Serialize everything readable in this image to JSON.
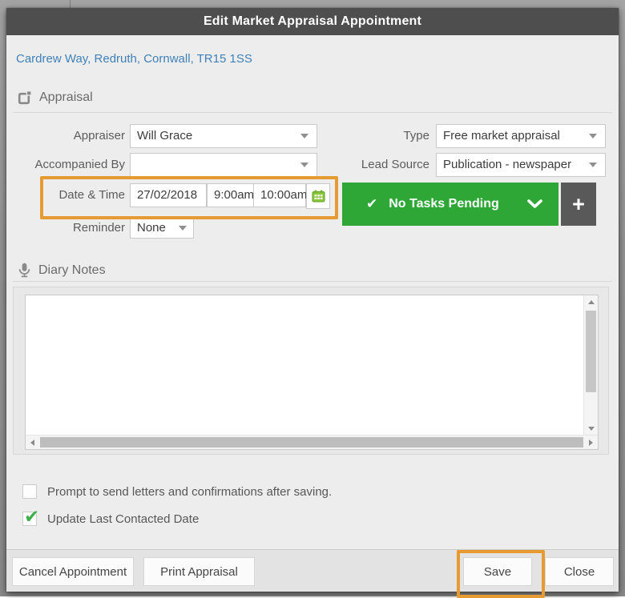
{
  "header": {
    "title": "Edit Market Appraisal Appointment"
  },
  "address_link": {
    "text": "Cardrew Way, Redruth, Cornwall, TR15 1SS"
  },
  "appraisal_section": {
    "title": "Appraisal",
    "appraiser": {
      "label": "Appraiser",
      "value": "Will Grace"
    },
    "accompanied_by": {
      "label": "Accompanied By",
      "value": ""
    },
    "date_time": {
      "label": "Date & Time",
      "date": "27/02/2018",
      "start_time": "9:00am",
      "end_time": "10:00am"
    },
    "reminder": {
      "label": "Reminder",
      "value": "None"
    },
    "type": {
      "label": "Type",
      "value": "Free market appraisal"
    },
    "lead_source": {
      "label": "Lead Source",
      "value": "Publication - newspaper"
    },
    "tasks_button_label": "No Tasks Pending"
  },
  "diary_section": {
    "title": "Diary Notes",
    "notes": ""
  },
  "checkboxes": {
    "prompt_letters": {
      "label": "Prompt to send letters and confirmations after saving.",
      "checked": false
    },
    "update_last_contacted": {
      "label": "Update Last Contacted Date",
      "checked": true
    }
  },
  "footer": {
    "cancel": "Cancel Appointment",
    "print": "Print Appraisal",
    "save": "Save",
    "close": "Close"
  },
  "icons": {
    "check": "✔",
    "plus": "+"
  },
  "colors": {
    "header_bg": "#4E4E4E",
    "annotation_orange": "#E59B31",
    "tasks_green": "#2EA737",
    "plus_grey": "#595959",
    "link_blue": "#3F81B8",
    "calendar_green": "#8DC63F",
    "checkmark_green": "#3FAE49"
  }
}
